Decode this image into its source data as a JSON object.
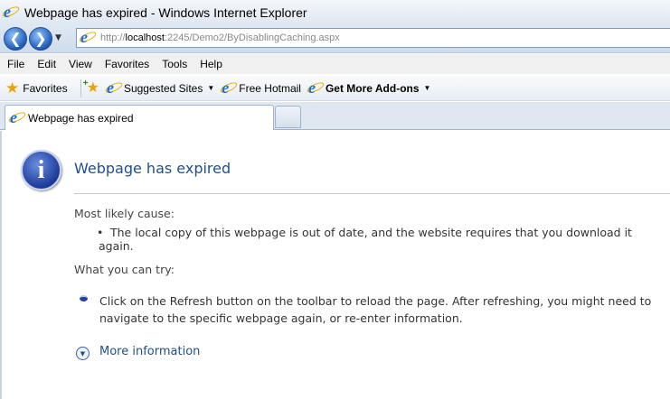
{
  "window": {
    "title": "Webpage has expired - Windows Internet Explorer"
  },
  "address_bar": {
    "url_prefix": "http://",
    "url_host": "localhost",
    "url_rest": ":2245/Demo2/ByDisablingCaching.aspx"
  },
  "menu": {
    "items": [
      "File",
      "Edit",
      "View",
      "Favorites",
      "Tools",
      "Help"
    ]
  },
  "favorites_bar": {
    "favorites_label": "Favorites",
    "suggested_sites": "Suggested Sites",
    "free_hotmail": "Free Hotmail",
    "get_more_addons": "Get More Add-ons"
  },
  "tabs": [
    {
      "label": "Webpage has expired"
    }
  ],
  "page": {
    "heading": "Webpage has expired",
    "cause_label": "Most likely cause:",
    "cause_item": "The local copy of this webpage is out of date, and the website requires that you download it again.",
    "try_label": "What you can try:",
    "try_item": "Click on the Refresh button on the toolbar to reload the page. After refreshing, you might need to navigate to the specific webpage again, or re-enter information.",
    "more_info": "More information"
  },
  "icons": {
    "ie": "internet-explorer-icon",
    "back": "back-arrow-icon",
    "forward": "forward-arrow-icon",
    "info": "information-icon",
    "expand": "expand-chevron-icon"
  },
  "colors": {
    "heading_blue": "#1f4f8f",
    "link_blue": "#1f4f8f",
    "ie_blue": "#1a6fcf"
  }
}
